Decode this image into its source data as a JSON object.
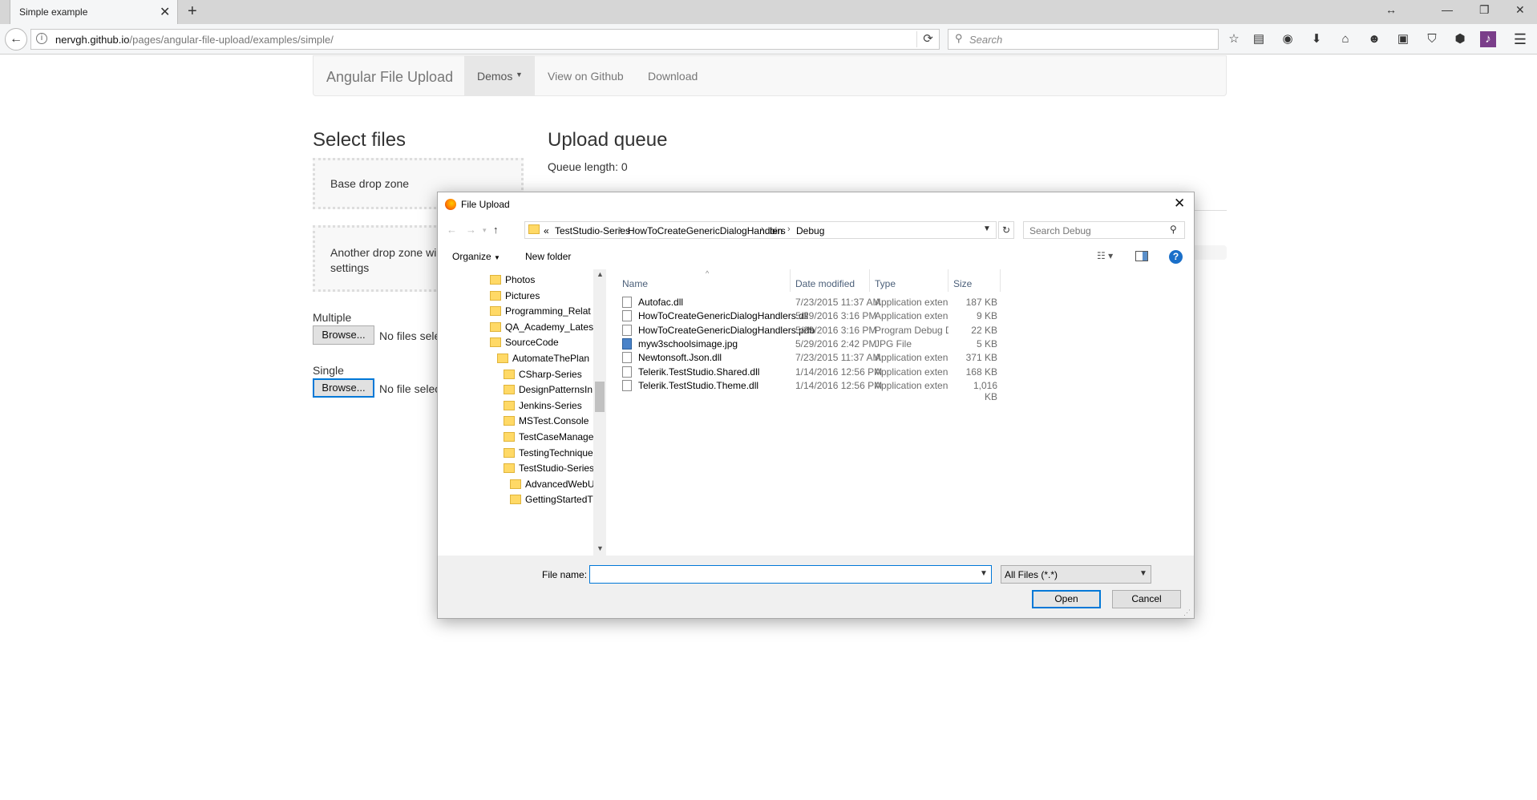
{
  "browser": {
    "tab_title": "Simple example",
    "url_host": "nervgh.github.io",
    "url_path": "/pages/angular-file-upload/examples/simple/",
    "search_placeholder": "Search"
  },
  "page": {
    "brand": "Angular File Upload",
    "nav": {
      "demos": "Demos",
      "github": "View on Github",
      "download": "Download"
    },
    "select_files_heading": "Select files",
    "upload_queue_heading": "Upload queue",
    "queue_length": "Queue length: 0",
    "dropzone_base": "Base drop zone",
    "dropzone_another_line1": "Another drop zone wi",
    "dropzone_another_line2": "settings",
    "multiple_label": "Multiple",
    "single_label": "Single",
    "browse_label": "Browse...",
    "no_files_selected": "No files sele",
    "no_file_selected": "No file selec"
  },
  "dialog": {
    "title": "File Upload",
    "breadcrumb": {
      "overflow": "«",
      "items": [
        "TestStudio-Series",
        "HowToCreateGenericDialogHandlers",
        "bin",
        "Debug"
      ]
    },
    "search_placeholder": "Search Debug",
    "toolbar": {
      "organize": "Organize",
      "new_folder": "New folder"
    },
    "tree": [
      {
        "label": "Photos"
      },
      {
        "label": "Pictures"
      },
      {
        "label": "Programming_Relat"
      },
      {
        "label": "QA_Academy_Lates"
      },
      {
        "label": "SourceCode"
      },
      {
        "label": "AutomateThePlan"
      },
      {
        "label": "CSharp-Series"
      },
      {
        "label": "DesignPatternsIn"
      },
      {
        "label": "Jenkins-Series"
      },
      {
        "label": "MSTest.Console"
      },
      {
        "label": "TestCaseManage"
      },
      {
        "label": "TestingTechnique"
      },
      {
        "label": "TestStudio-Series"
      },
      {
        "label": "AdvancedWebU"
      },
      {
        "label": "GettingStartedT"
      }
    ],
    "columns": {
      "name": "Name",
      "date": "Date modified",
      "type": "Type",
      "size": "Size"
    },
    "files": [
      {
        "name": "Autofac.dll",
        "date": "7/23/2015 11:37 AM",
        "type": "Application extens...",
        "size": "187 KB",
        "icon": "dll-icon"
      },
      {
        "name": "HowToCreateGenericDialogHandlers.dll",
        "date": "5/29/2016 3:16 PM",
        "type": "Application extens...",
        "size": "9 KB",
        "icon": "dll-icon"
      },
      {
        "name": "HowToCreateGenericDialogHandlers.pdb",
        "date": "5/29/2016 3:16 PM",
        "type": "Program Debug D...",
        "size": "22 KB",
        "icon": "pdb-icon"
      },
      {
        "name": "myw3schoolsimage.jpg",
        "date": "5/29/2016 2:42 PM",
        "type": "JPG File",
        "size": "5 KB",
        "icon": "image-icon"
      },
      {
        "name": "Newtonsoft.Json.dll",
        "date": "7/23/2015 11:37 AM",
        "type": "Application extens...",
        "size": "371 KB",
        "icon": "dll-icon"
      },
      {
        "name": "Telerik.TestStudio.Shared.dll",
        "date": "1/14/2016 12:56 PM",
        "type": "Application extens...",
        "size": "168 KB",
        "icon": "dll-icon"
      },
      {
        "name": "Telerik.TestStudio.Theme.dll",
        "date": "1/14/2016 12:56 PM",
        "type": "Application extens...",
        "size": "1,016 KB",
        "icon": "dll-icon"
      }
    ],
    "file_name_label": "File name:",
    "file_name_value": "",
    "file_type": "All Files (*.*)",
    "open_label": "Open",
    "cancel_label": "Cancel"
  }
}
